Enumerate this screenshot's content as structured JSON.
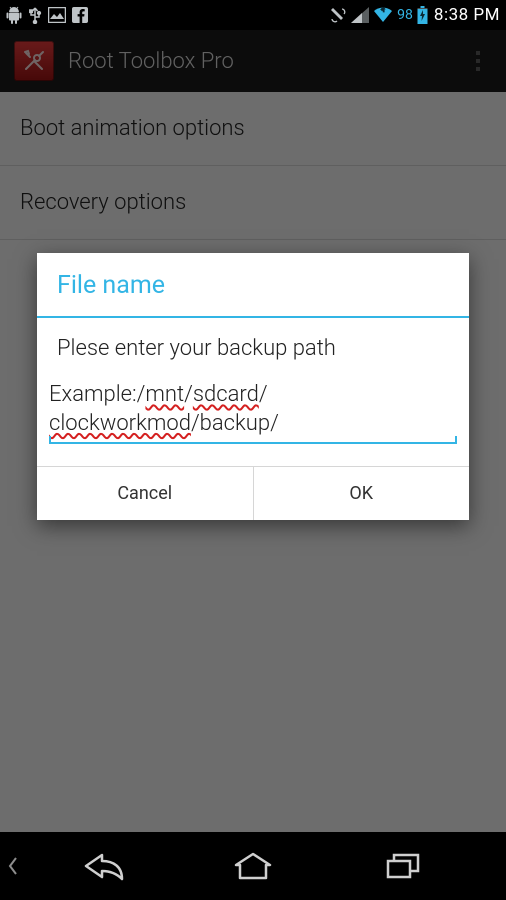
{
  "status": {
    "battery_pct": "98",
    "time": "8:38 PM"
  },
  "action_bar": {
    "title": "Root Toolbox Pro"
  },
  "list": {
    "items": [
      {
        "label": "Boot animation options"
      },
      {
        "label": "Recovery options"
      }
    ]
  },
  "dialog": {
    "title": "File name",
    "message": "Plese enter your backup path",
    "input_prefix": "Example:/",
    "sp1": "mnt",
    "sep1": "/",
    "sp2": "sdcard",
    "sep2": "/",
    "sp3": "clockworkmod",
    "suffix": "/backup/",
    "cancel": "Cancel",
    "ok": "OK"
  }
}
